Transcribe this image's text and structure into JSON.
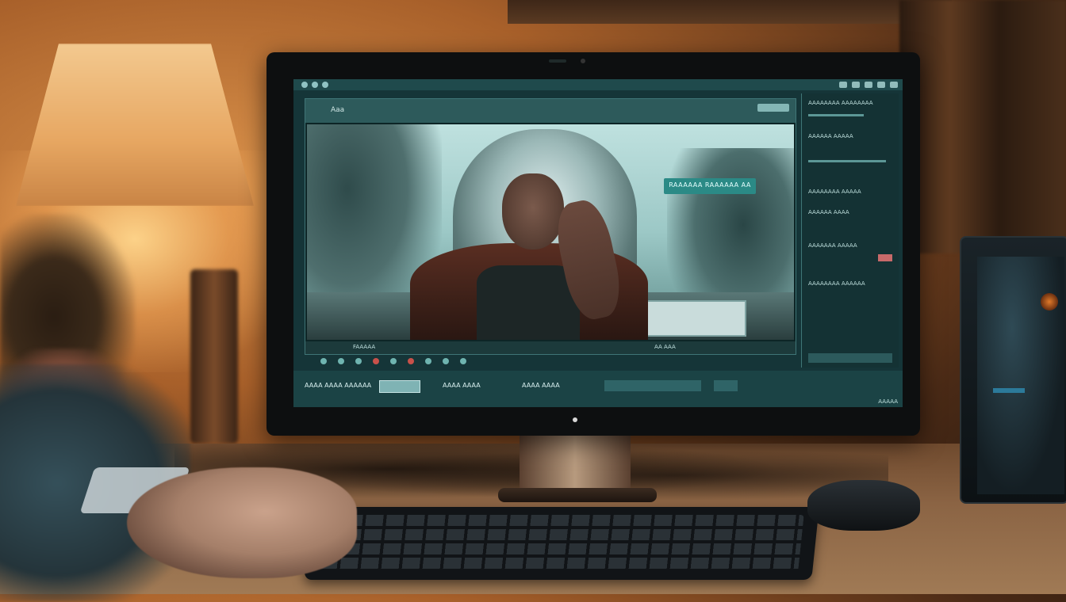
{
  "scene": {
    "description_labels": {
      "monitor": "monitor",
      "keyboard": "keyboard",
      "lamp": "lamp"
    }
  },
  "screen": {
    "viewer_label": "Aaa",
    "caption": "RAAAAAA RAAAAAA AA",
    "scrub_label": "FAAAAA",
    "scrub_time": "AA AAA",
    "status": "AAAAA",
    "tracks": [
      {
        "label": "AAAA AAAA AAAAAA"
      },
      {
        "label": "AAAA AAAA"
      },
      {
        "label": "AAAA AAAA"
      }
    ],
    "sidepanel_rows": [
      "AAAAAAAA AAAAAAAA",
      "AAAAAA AAAAA",
      "AAAAAAAA AAAAA",
      "AAAAAA AAAA",
      "AAAAAAA AAAAA",
      "AAAAAAAA AAAAAA"
    ]
  }
}
